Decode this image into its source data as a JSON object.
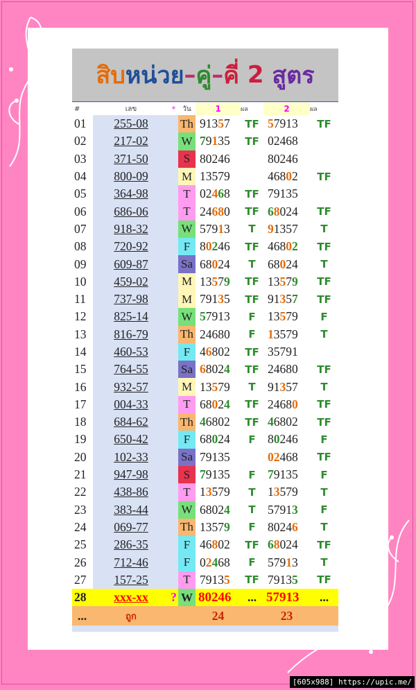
{
  "title": {
    "part1": "สิบ",
    "part2": "หน่วย",
    "sep1": "–",
    "part3": "คู่",
    "sep2": "–",
    "part4": "คี่",
    "part5": " 2 ",
    "part6": "สูตร"
  },
  "header": {
    "hash": "#",
    "code": "เลข",
    "star": "*",
    "day": "วัน",
    "f1": "1",
    "f1res": "ผล",
    "f2": "2",
    "f2res": "ผล"
  },
  "rows": [
    {
      "no": "01",
      "code": "255-08",
      "day": "Th",
      "n1": [
        [
          "9",
          "n"
        ],
        [
          "1",
          "n"
        ],
        [
          "3",
          "n"
        ],
        [
          "5",
          "o"
        ],
        [
          "7",
          "n"
        ]
      ],
      "r1": "TF",
      "n2": [
        [
          "5",
          "o"
        ],
        [
          "7",
          "n"
        ],
        [
          "9",
          "n"
        ],
        [
          "1",
          "n"
        ],
        [
          "3",
          "n"
        ]
      ],
      "r2": "TF"
    },
    {
      "no": "02",
      "code": "217-02",
      "day": "W",
      "n1": [
        [
          "7",
          "g"
        ],
        [
          "9",
          "n"
        ],
        [
          "1",
          "o"
        ],
        [
          "3",
          "n"
        ],
        [
          "5",
          "n"
        ]
      ],
      "r1": "TF",
      "n2": [
        [
          "0",
          "n"
        ],
        [
          "2",
          "n"
        ],
        [
          "4",
          "n"
        ],
        [
          "6",
          "n"
        ],
        [
          "8",
          "n"
        ]
      ],
      "r2": ""
    },
    {
      "no": "03",
      "code": "371-50",
      "day": "S",
      "n1": [
        [
          "8",
          "n"
        ],
        [
          "0",
          "n"
        ],
        [
          "2",
          "n"
        ],
        [
          "4",
          "n"
        ],
        [
          "6",
          "n"
        ]
      ],
      "r1": "",
      "n2": [
        [
          "8",
          "n"
        ],
        [
          "0",
          "n"
        ],
        [
          "2",
          "n"
        ],
        [
          "4",
          "n"
        ],
        [
          "6",
          "n"
        ]
      ],
      "r2": ""
    },
    {
      "no": "04",
      "code": "800-09",
      "day": "M",
      "n1": [
        [
          "1",
          "n"
        ],
        [
          "3",
          "n"
        ],
        [
          "5",
          "n"
        ],
        [
          "7",
          "n"
        ],
        [
          "9",
          "n"
        ]
      ],
      "r1": "",
      "n2": [
        [
          "4",
          "n"
        ],
        [
          "6",
          "n"
        ],
        [
          "8",
          "n"
        ],
        [
          "0",
          "o"
        ],
        [
          "2",
          "n"
        ]
      ],
      "r2": "TF"
    },
    {
      "no": "05",
      "code": "364-98",
      "day": "T",
      "n1": [
        [
          "0",
          "n"
        ],
        [
          "2",
          "n"
        ],
        [
          "4",
          "o"
        ],
        [
          "6",
          "g"
        ],
        [
          "8",
          "n"
        ]
      ],
      "r1": "TF",
      "n2": [
        [
          "7",
          "n"
        ],
        [
          "9",
          "n"
        ],
        [
          "1",
          "n"
        ],
        [
          "3",
          "n"
        ],
        [
          "5",
          "n"
        ]
      ],
      "r2": ""
    },
    {
      "no": "06",
      "code": "686-06",
      "day": "T",
      "n1": [
        [
          "2",
          "n"
        ],
        [
          "4",
          "n"
        ],
        [
          "6",
          "o"
        ],
        [
          "8",
          "o"
        ],
        [
          "0",
          "n"
        ]
      ],
      "r1": "TF",
      "n2": [
        [
          "6",
          "g"
        ],
        [
          "8",
          "o"
        ],
        [
          "0",
          "n"
        ],
        [
          "2",
          "n"
        ],
        [
          "4",
          "n"
        ]
      ],
      "r2": "TF"
    },
    {
      "no": "07",
      "code": "918-32",
      "day": "W",
      "n1": [
        [
          "5",
          "n"
        ],
        [
          "7",
          "n"
        ],
        [
          "9",
          "n"
        ],
        [
          "1",
          "o"
        ],
        [
          "3",
          "n"
        ]
      ],
      "r1": "T",
      "n2": [
        [
          "9",
          "o"
        ],
        [
          "1",
          "n"
        ],
        [
          "3",
          "n"
        ],
        [
          "5",
          "n"
        ],
        [
          "7",
          "n"
        ]
      ],
      "r2": "T"
    },
    {
      "no": "08",
      "code": "720-92",
      "day": "F",
      "n1": [
        [
          "8",
          "n"
        ],
        [
          "0",
          "o"
        ],
        [
          "2",
          "g"
        ],
        [
          "4",
          "n"
        ],
        [
          "6",
          "n"
        ]
      ],
      "r1": "TF",
      "n2": [
        [
          "4",
          "n"
        ],
        [
          "6",
          "n"
        ],
        [
          "8",
          "n"
        ],
        [
          "0",
          "o"
        ],
        [
          "2",
          "g"
        ]
      ],
      "r2": "TF"
    },
    {
      "no": "09",
      "code": "609-87",
      "day": "Sa",
      "n1": [
        [
          "6",
          "n"
        ],
        [
          "8",
          "n"
        ],
        [
          "0",
          "o"
        ],
        [
          "2",
          "n"
        ],
        [
          "4",
          "n"
        ]
      ],
      "r1": "T",
      "n2": [
        [
          "6",
          "n"
        ],
        [
          "8",
          "n"
        ],
        [
          "0",
          "o"
        ],
        [
          "2",
          "n"
        ],
        [
          "4",
          "n"
        ]
      ],
      "r2": "T"
    },
    {
      "no": "10",
      "code": "459-02",
      "day": "M",
      "n1": [
        [
          "1",
          "n"
        ],
        [
          "3",
          "n"
        ],
        [
          "5",
          "o"
        ],
        [
          "7",
          "n"
        ],
        [
          "9",
          "g"
        ]
      ],
      "r1": "TF",
      "n2": [
        [
          "1",
          "n"
        ],
        [
          "3",
          "n"
        ],
        [
          "5",
          "o"
        ],
        [
          "7",
          "n"
        ],
        [
          "9",
          "g"
        ]
      ],
      "r2": "TF"
    },
    {
      "no": "11",
      "code": "737-98",
      "day": "M",
      "n1": [
        [
          "7",
          "n"
        ],
        [
          "9",
          "n"
        ],
        [
          "1",
          "n"
        ],
        [
          "3",
          "o"
        ],
        [
          "5",
          "n"
        ]
      ],
      "r1": "TF",
      "n2": [
        [
          "9",
          "n"
        ],
        [
          "1",
          "n"
        ],
        [
          "3",
          "o"
        ],
        [
          "5",
          "n"
        ],
        [
          "7",
          "g"
        ]
      ],
      "r2": "TF"
    },
    {
      "no": "12",
      "code": "825-14",
      "day": "W",
      "n1": [
        [
          "5",
          "g"
        ],
        [
          "7",
          "n"
        ],
        [
          "9",
          "n"
        ],
        [
          "1",
          "n"
        ],
        [
          "3",
          "n"
        ]
      ],
      "r1": "F",
      "n2": [
        [
          "1",
          "n"
        ],
        [
          "3",
          "n"
        ],
        [
          "5",
          "o"
        ],
        [
          "7",
          "n"
        ],
        [
          "9",
          "n"
        ]
      ],
      "r2": "F"
    },
    {
      "no": "13",
      "code": "816-79",
      "day": "Th",
      "n1": [
        [
          "2",
          "n"
        ],
        [
          "4",
          "n"
        ],
        [
          "6",
          "n"
        ],
        [
          "8",
          "n"
        ],
        [
          "0",
          "n"
        ]
      ],
      "r1": "F",
      "n2": [
        [
          "1",
          "o"
        ],
        [
          "3",
          "n"
        ],
        [
          "5",
          "n"
        ],
        [
          "7",
          "n"
        ],
        [
          "9",
          "n"
        ]
      ],
      "r2": "T"
    },
    {
      "no": "14",
      "code": "460-53",
      "day": "F",
      "n1": [
        [
          "4",
          "n"
        ],
        [
          "6",
          "o"
        ],
        [
          "8",
          "n"
        ],
        [
          "0",
          "n"
        ],
        [
          "2",
          "n"
        ]
      ],
      "r1": "TF",
      "n2": [
        [
          "3",
          "n"
        ],
        [
          "5",
          "n"
        ],
        [
          "7",
          "n"
        ],
        [
          "9",
          "n"
        ],
        [
          "1",
          "n"
        ]
      ],
      "r2": ""
    },
    {
      "no": "15",
      "code": "764-55",
      "day": "Sa",
      "n1": [
        [
          "6",
          "o"
        ],
        [
          "8",
          "n"
        ],
        [
          "0",
          "n"
        ],
        [
          "2",
          "n"
        ],
        [
          "4",
          "g"
        ]
      ],
      "r1": "TF",
      "n2": [
        [
          "2",
          "n"
        ],
        [
          "4",
          "n"
        ],
        [
          "6",
          "n"
        ],
        [
          "8",
          "n"
        ],
        [
          "0",
          "n"
        ]
      ],
      "r2": "TF"
    },
    {
      "no": "16",
      "code": "932-57",
      "day": "M",
      "n1": [
        [
          "1",
          "n"
        ],
        [
          "3",
          "n"
        ],
        [
          "5",
          "o"
        ],
        [
          "7",
          "n"
        ],
        [
          "9",
          "n"
        ]
      ],
      "r1": "T",
      "n2": [
        [
          "9",
          "n"
        ],
        [
          "1",
          "n"
        ],
        [
          "3",
          "o"
        ],
        [
          "5",
          "n"
        ],
        [
          "7",
          "n"
        ]
      ],
      "r2": "T"
    },
    {
      "no": "17",
      "code": "004-33",
      "day": "T",
      "n1": [
        [
          "6",
          "n"
        ],
        [
          "8",
          "n"
        ],
        [
          "0",
          "o"
        ],
        [
          "2",
          "n"
        ],
        [
          "4",
          "g"
        ]
      ],
      "r1": "TF",
      "n2": [
        [
          "2",
          "n"
        ],
        [
          "4",
          "n"
        ],
        [
          "6",
          "n"
        ],
        [
          "8",
          "n"
        ],
        [
          "0",
          "o"
        ]
      ],
      "r2": "TF"
    },
    {
      "no": "18",
      "code": "684-62",
      "day": "Th",
      "n1": [
        [
          "4",
          "g"
        ],
        [
          "6",
          "n"
        ],
        [
          "8",
          "n"
        ],
        [
          "0",
          "n"
        ],
        [
          "2",
          "n"
        ]
      ],
      "r1": "TF",
      "n2": [
        [
          "4",
          "g"
        ],
        [
          "6",
          "n"
        ],
        [
          "8",
          "n"
        ],
        [
          "0",
          "n"
        ],
        [
          "2",
          "n"
        ]
      ],
      "r2": "TF"
    },
    {
      "no": "19",
      "code": "650-42",
      "day": "F",
      "n1": [
        [
          "6",
          "n"
        ],
        [
          "8",
          "n"
        ],
        [
          "0",
          "g"
        ],
        [
          "2",
          "n"
        ],
        [
          "4",
          "n"
        ]
      ],
      "r1": "F",
      "n2": [
        [
          "8",
          "n"
        ],
        [
          "0",
          "g"
        ],
        [
          "2",
          "n"
        ],
        [
          "4",
          "n"
        ],
        [
          "6",
          "n"
        ]
      ],
      "r2": "F"
    },
    {
      "no": "20",
      "code": "102-33",
      "day": "Sa",
      "n1": [
        [
          "7",
          "n"
        ],
        [
          "9",
          "n"
        ],
        [
          "1",
          "n"
        ],
        [
          "3",
          "n"
        ],
        [
          "5",
          "n"
        ]
      ],
      "r1": "",
      "n2": [
        [
          "0",
          "o"
        ],
        [
          "2",
          "o"
        ],
        [
          "4",
          "n"
        ],
        [
          "6",
          "n"
        ],
        [
          "8",
          "n"
        ]
      ],
      "r2": "TF"
    },
    {
      "no": "21",
      "code": "947-98",
      "day": "S",
      "n1": [
        [
          "7",
          "g"
        ],
        [
          "9",
          "n"
        ],
        [
          "1",
          "n"
        ],
        [
          "3",
          "n"
        ],
        [
          "5",
          "n"
        ]
      ],
      "r1": "F",
      "n2": [
        [
          "7",
          "g"
        ],
        [
          "9",
          "n"
        ],
        [
          "1",
          "n"
        ],
        [
          "3",
          "n"
        ],
        [
          "5",
          "n"
        ]
      ],
      "r2": "F"
    },
    {
      "no": "22",
      "code": "438-86",
      "day": "T",
      "n1": [
        [
          "1",
          "n"
        ],
        [
          "3",
          "o"
        ],
        [
          "5",
          "n"
        ],
        [
          "7",
          "n"
        ],
        [
          "9",
          "n"
        ]
      ],
      "r1": "T",
      "n2": [
        [
          "1",
          "n"
        ],
        [
          "3",
          "o"
        ],
        [
          "5",
          "n"
        ],
        [
          "7",
          "n"
        ],
        [
          "9",
          "n"
        ]
      ],
      "r2": "T"
    },
    {
      "no": "23",
      "code": "383-44",
      "day": "W",
      "n1": [
        [
          "6",
          "n"
        ],
        [
          "8",
          "n"
        ],
        [
          "0",
          "n"
        ],
        [
          "2",
          "n"
        ],
        [
          "4",
          "g"
        ]
      ],
      "r1": "T",
      "n2": [
        [
          "5",
          "n"
        ],
        [
          "7",
          "n"
        ],
        [
          "9",
          "n"
        ],
        [
          "1",
          "n"
        ],
        [
          "3",
          "g"
        ]
      ],
      "r2": "F"
    },
    {
      "no": "24",
      "code": "069-77",
      "day": "Th",
      "n1": [
        [
          "1",
          "n"
        ],
        [
          "3",
          "n"
        ],
        [
          "5",
          "n"
        ],
        [
          "7",
          "n"
        ],
        [
          "9",
          "g"
        ]
      ],
      "r1": "F",
      "n2": [
        [
          "8",
          "n"
        ],
        [
          "0",
          "n"
        ],
        [
          "2",
          "n"
        ],
        [
          "4",
          "n"
        ],
        [
          "6",
          "o"
        ]
      ],
      "r2": "T"
    },
    {
      "no": "25",
      "code": "286-35",
      "day": "F",
      "n1": [
        [
          "4",
          "n"
        ],
        [
          "6",
          "n"
        ],
        [
          "8",
          "o"
        ],
        [
          "0",
          "n"
        ],
        [
          "2",
          "n"
        ]
      ],
      "r1": "TF",
      "n2": [
        [
          "6",
          "g"
        ],
        [
          "8",
          "o"
        ],
        [
          "0",
          "n"
        ],
        [
          "2",
          "n"
        ],
        [
          "4",
          "n"
        ]
      ],
      "r2": "TF"
    },
    {
      "no": "26",
      "code": "712-46",
      "day": "F",
      "n1": [
        [
          "0",
          "n"
        ],
        [
          "2",
          "o"
        ],
        [
          "4",
          "g"
        ],
        [
          "6",
          "n"
        ],
        [
          "8",
          "n"
        ]
      ],
      "r1": "F",
      "n2": [
        [
          "5",
          "n"
        ],
        [
          "7",
          "n"
        ],
        [
          "9",
          "n"
        ],
        [
          "1",
          "o"
        ],
        [
          "3",
          "n"
        ]
      ],
      "r2": "T"
    },
    {
      "no": "27",
      "code": "157-25",
      "day": "T",
      "n1": [
        [
          "7",
          "n"
        ],
        [
          "9",
          "n"
        ],
        [
          "1",
          "n"
        ],
        [
          "3",
          "n"
        ],
        [
          "5",
          "o"
        ]
      ],
      "r1": "TF",
      "n2": [
        [
          "7",
          "n"
        ],
        [
          "9",
          "n"
        ],
        [
          "1",
          "n"
        ],
        [
          "3",
          "n"
        ],
        [
          "5",
          "g"
        ]
      ],
      "r2": "TF"
    }
  ],
  "last_row": {
    "no": "28",
    "code": "xxx-xx",
    "q": "?",
    "day": "W",
    "n1": "80246",
    "r1": "...",
    "n2": "57913",
    "r2": "..."
  },
  "footer_row": {
    "dots": "...",
    "label": "ถูก",
    "c1": "24",
    "c2": "23"
  },
  "watermark": "[605x988] https://upic.me/"
}
